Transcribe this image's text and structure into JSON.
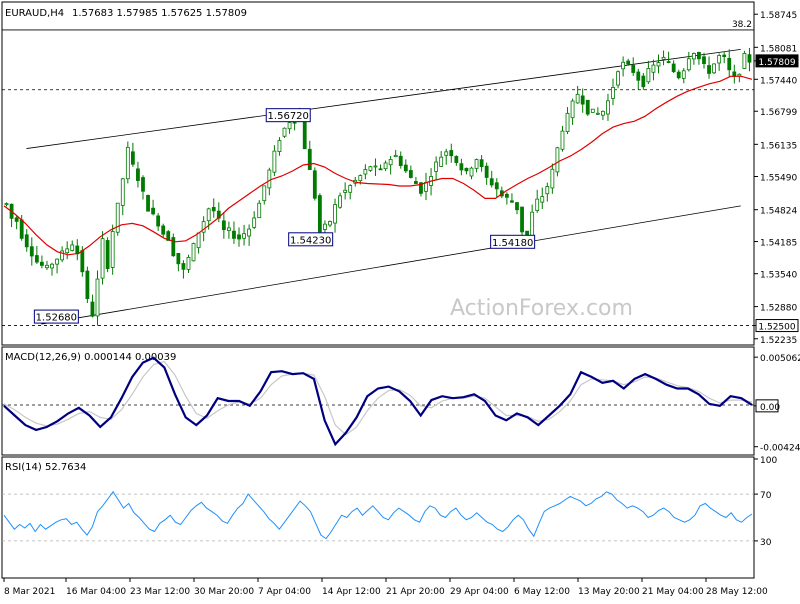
{
  "header": {
    "symbol": "EURAUD,H4",
    "ohlc": "1.57683 1.57985 1.57625 1.57809"
  },
  "watermark": "ActionForex.com",
  "colors": {
    "candle": "#007a00",
    "ma": "#e00000",
    "macd": "#000080",
    "signal": "#c8c8c8",
    "rsi": "#1e90ff",
    "channel": "#000000",
    "grid": "#000000",
    "tag_border": "#000080",
    "fib": "#000000"
  },
  "chart_data": [
    {
      "name": "price-panel",
      "type": "candlestick",
      "y_ticks": [
        "1.58745",
        "1.58081",
        "1.57809",
        "1.57440",
        "1.56799",
        "1.56135",
        "1.55490",
        "1.54824",
        "1.54185",
        "1.53540",
        "1.52880",
        "1.52500",
        "1.52235"
      ],
      "ylim": [
        1.5215,
        1.5895
      ],
      "last_price": 1.57809,
      "hlines": [
        {
          "id": "fib",
          "value": 1.5843,
          "label": "38.2"
        },
        {
          "id": "support-high",
          "value": 1.5723,
          "label": "1.57230"
        },
        {
          "id": "support-low",
          "value": 1.525,
          "label": "1.52500"
        }
      ],
      "price_tags": [
        {
          "label": "1.52680",
          "value": 1.5268
        },
        {
          "label": "1.56720",
          "value": 1.5672
        },
        {
          "label": "1.54230",
          "value": 1.5423
        },
        {
          "label": "1.54180",
          "value": 1.5418
        }
      ],
      "channel": {
        "upper": [
          [
            0.03,
            1.5605
          ],
          [
            0.985,
            1.5804
          ]
        ],
        "lower": [
          [
            0.05,
            1.5253
          ],
          [
            0.985,
            1.549
          ]
        ]
      },
      "series": [
        {
          "id": "price",
          "values": [
            1.5494,
            1.5465,
            1.546,
            1.543,
            1.5412,
            1.5395,
            1.5378,
            1.537,
            1.5365,
            1.5375,
            1.5385,
            1.5395,
            1.5405,
            1.5415,
            1.5395,
            1.536,
            1.53,
            1.5272,
            1.534,
            1.542,
            1.537,
            1.544,
            1.549,
            1.5545,
            1.5603,
            1.557,
            1.5545,
            1.5515,
            1.5485,
            1.547,
            1.5455,
            1.5435,
            1.5425,
            1.5395,
            1.5375,
            1.536,
            1.5385,
            1.541,
            1.5438,
            1.546,
            1.5485,
            1.548,
            1.546,
            1.544,
            1.544,
            1.543,
            1.5425,
            1.5435,
            1.5445,
            1.547,
            1.5495,
            1.553,
            1.556,
            1.5595,
            1.5625,
            1.5645,
            1.566,
            1.5662,
            1.5668,
            1.5608,
            1.556,
            1.5508,
            1.5438,
            1.5448,
            1.546,
            1.549,
            1.5512,
            1.552,
            1.553,
            1.554,
            1.555,
            1.556,
            1.557,
            1.5565,
            1.556,
            1.5578,
            1.5585,
            1.559,
            1.5575,
            1.556,
            1.5545,
            1.5535,
            1.552,
            1.5535,
            1.5555,
            1.5575,
            1.559,
            1.56,
            1.5595,
            1.558,
            1.5565,
            1.5555,
            1.557,
            1.5585,
            1.5565,
            1.5545,
            1.5535,
            1.5525,
            1.551,
            1.5505,
            1.5498,
            1.5485,
            1.544,
            1.5425,
            1.5475,
            1.55,
            1.551,
            1.553,
            1.556,
            1.5605,
            1.5645,
            1.567,
            1.5695,
            1.5715,
            1.57,
            1.568,
            1.5678,
            1.5675,
            1.568,
            1.57,
            1.573,
            1.5765,
            1.5775,
            1.577,
            1.576,
            1.5745,
            1.5735,
            1.576,
            1.577,
            1.578,
            1.5785,
            1.5775,
            1.576,
            1.575,
            1.5765,
            1.579,
            1.58,
            1.5785,
            1.577,
            1.576,
            1.5775,
            1.579,
            1.5785,
            1.576,
            1.5745,
            1.576,
            1.579,
            1.5781
          ]
        },
        {
          "id": "ma",
          "values": [
            1.549,
            1.5474,
            1.5455,
            1.5432,
            1.5412,
            1.5398,
            1.5392,
            1.5395,
            1.541,
            1.5428,
            1.5442,
            1.5452,
            1.5455,
            1.545,
            1.5438,
            1.5425,
            1.5418,
            1.542,
            1.5432,
            1.5448,
            1.5465,
            1.5485,
            1.55,
            1.5515,
            1.553,
            1.5543,
            1.555,
            1.556,
            1.5572,
            1.5575,
            1.5568,
            1.5555,
            1.5545,
            1.5537,
            1.5535,
            1.5534,
            1.5533,
            1.553,
            1.553,
            1.5533,
            1.554,
            1.5545,
            1.5545,
            1.5535,
            1.5521,
            1.5505,
            1.5505,
            1.552,
            1.5533,
            1.5545,
            1.5555,
            1.5567,
            1.558,
            1.559,
            1.5603,
            1.5618,
            1.5635,
            1.5648,
            1.5655,
            1.566,
            1.567,
            1.5685,
            1.5698,
            1.571,
            1.572,
            1.5728,
            1.5735,
            1.574,
            1.575,
            1.575,
            1.5744
          ]
        }
      ]
    },
    {
      "name": "macd-panel",
      "type": "line",
      "label": "MACD(12,26,9) 0.000144 0.00039",
      "y_ticks": [
        "0.005062",
        "0.00",
        "-0.004248"
      ],
      "zero_label": "0.00",
      "ylim": [
        -0.0048,
        0.0056
      ],
      "series": [
        {
          "id": "macd",
          "values": [
            0.0,
            -0.001,
            -0.002,
            -0.0025,
            -0.0022,
            -0.0016,
            -0.0008,
            -0.0002,
            -0.001,
            -0.0022,
            -0.0012,
            0.0008,
            0.003,
            0.0045,
            0.005,
            0.004,
            0.0012,
            -0.0012,
            -0.002,
            -0.001,
            0.0008,
            0.0005,
            0.0005,
            0.0,
            0.0015,
            0.0035,
            0.0036,
            0.0033,
            0.0034,
            0.0028,
            -0.0015,
            -0.004,
            -0.0028,
            -0.0012,
            0.001,
            0.0018,
            0.002,
            0.0015,
            0.0005,
            -0.001,
            0.0006,
            0.001,
            0.0008,
            0.0009,
            0.0012,
            0.0005,
            -0.001,
            -0.0015,
            -0.0008,
            -0.0012,
            -0.002,
            -0.001,
            0.0,
            0.0012,
            0.0035,
            0.003,
            0.0024,
            0.0026,
            0.0018,
            0.0028,
            0.0033,
            0.0028,
            0.0022,
            0.0018,
            0.0018,
            0.0012,
            0.0002,
            0.0,
            0.001,
            0.0008,
            0.0001
          ]
        },
        {
          "id": "signal",
          "values": [
            0.0002,
            -0.0004,
            -0.0012,
            -0.0018,
            -0.0021,
            -0.0019,
            -0.0014,
            -0.0008,
            -0.0006,
            -0.0012,
            -0.0014,
            -0.0004,
            0.0012,
            0.003,
            0.0043,
            0.0046,
            0.0032,
            0.001,
            -0.0008,
            -0.0013,
            -0.0005,
            0.0001,
            0.0004,
            0.0002,
            0.0008,
            0.0022,
            0.0031,
            0.0033,
            0.0034,
            0.0032,
            0.001,
            -0.002,
            -0.003,
            -0.0022,
            -0.0005,
            0.0008,
            0.0016,
            0.0017,
            0.0011,
            0.0,
            -0.0002,
            0.0005,
            0.0008,
            0.0008,
            0.001,
            0.0008,
            -0.0001,
            -0.001,
            -0.001,
            -0.0011,
            -0.0016,
            -0.0014,
            -0.0006,
            0.0005,
            0.0022,
            0.0028,
            0.0027,
            0.0026,
            0.0022,
            0.0025,
            0.003,
            0.0029,
            0.0025,
            0.0021,
            0.0019,
            0.0015,
            0.0008,
            0.0003,
            0.0006,
            0.0006,
            0.0004
          ]
        }
      ]
    },
    {
      "name": "rsi-panel",
      "type": "line",
      "label": "RSI(14) 52.7634",
      "y_ticks": [
        "100",
        "70",
        "30",
        "0"
      ],
      "ylim": [
        0,
        100
      ],
      "hlines": [
        70,
        30
      ],
      "series": [
        {
          "id": "rsi",
          "values": [
            52,
            46,
            40,
            44,
            41,
            45,
            38,
            44,
            40,
            43,
            46,
            48,
            49,
            44,
            46,
            40,
            35,
            42,
            55,
            60,
            66,
            72,
            65,
            58,
            62,
            54,
            50,
            45,
            40,
            38,
            45,
            48,
            52,
            46,
            44,
            50,
            56,
            60,
            63,
            58,
            55,
            52,
            47,
            45,
            52,
            58,
            62,
            70,
            65,
            60,
            55,
            49,
            45,
            40,
            46,
            52,
            58,
            64,
            60,
            55,
            45,
            35,
            32,
            38,
            45,
            52,
            50,
            55,
            58,
            52,
            56,
            60,
            55,
            50,
            48,
            54,
            58,
            55,
            52,
            48,
            46,
            55,
            60,
            58,
            52,
            50,
            55,
            58,
            52,
            48,
            50,
            54,
            50,
            46,
            44,
            40,
            38,
            42,
            48,
            52,
            48,
            40,
            34,
            45,
            55,
            58,
            60,
            62,
            65,
            68,
            66,
            64,
            60,
            62,
            66,
            68,
            72,
            70,
            65,
            62,
            58,
            60,
            58,
            55,
            50,
            52,
            56,
            58,
            55,
            50,
            48,
            46,
            48,
            52,
            60,
            62,
            58,
            55,
            52,
            50,
            54,
            48,
            46,
            50,
            53
          ]
        }
      ]
    }
  ],
  "x_axis": {
    "labels": [
      "8 Mar 2021",
      "16 Mar 04:00",
      "23 Mar 12:00",
      "30 Mar 20:00",
      "7 Apr 04:00",
      "14 Apr 12:00",
      "21 Apr 20:00",
      "29 Apr 04:00",
      "6 May 12:00",
      "13 May 20:00",
      "21 May 04:00",
      "28 May 12:00"
    ]
  }
}
